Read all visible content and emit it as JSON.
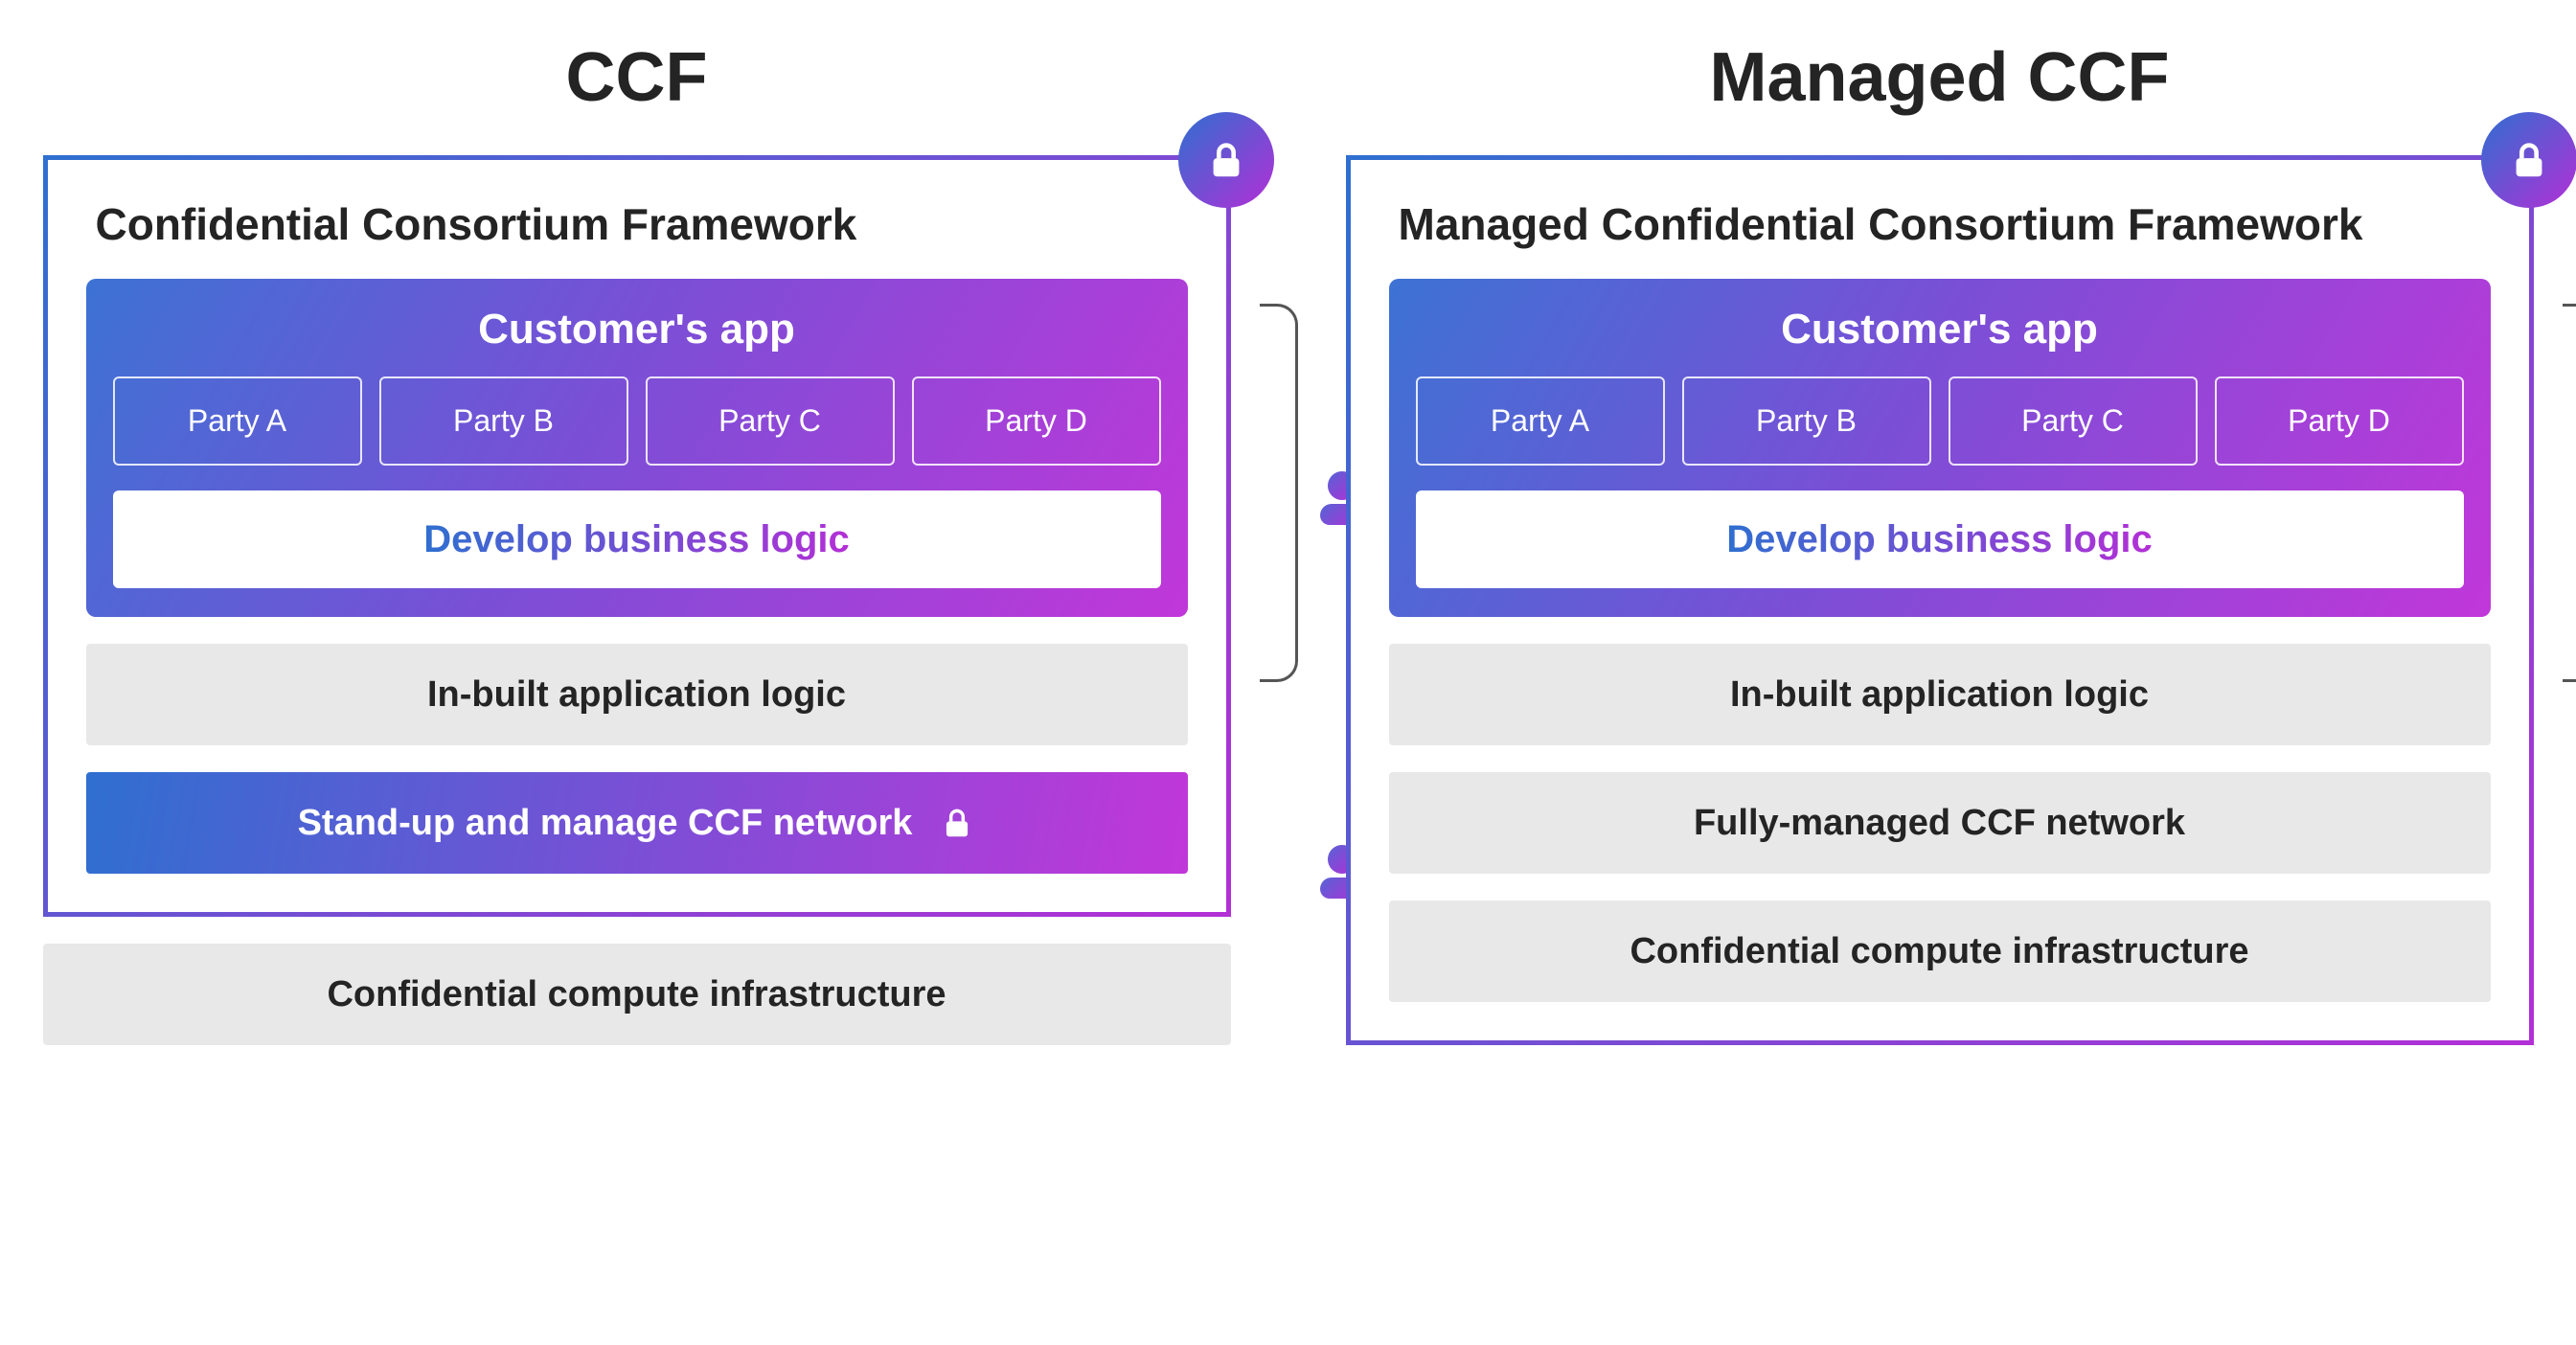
{
  "left": {
    "title": "CCF",
    "framework_title": "Confidential Consortium Framework",
    "app_title": "Customer's app",
    "parties": [
      "Party A",
      "Party B",
      "Party C",
      "Party D"
    ],
    "develop": "Develop business logic",
    "inbuilt": "In-built application logic",
    "network": "Stand-up and manage CCF network",
    "infra": "Confidential compute infrastructure"
  },
  "right": {
    "title": "Managed CCF",
    "framework_title": "Managed Confidential Consortium Framework",
    "app_title": "Customer's app",
    "parties": [
      "Party A",
      "Party B",
      "Party C",
      "Party D"
    ],
    "develop": "Develop business logic",
    "inbuilt": "In-built application logic",
    "network": "Fully-managed CCF network",
    "infra": "Confidential compute infrastructure"
  }
}
